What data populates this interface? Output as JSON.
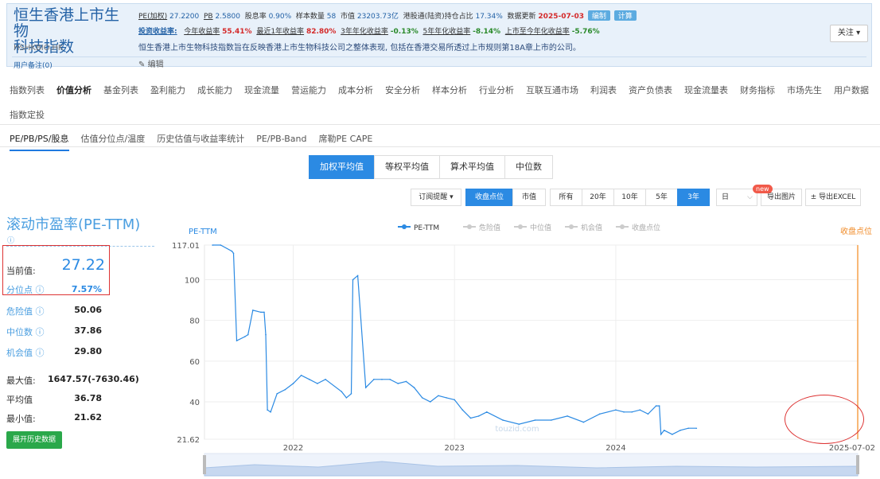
{
  "header": {
    "title_line1": "恒生香港上市生物",
    "title_line2": "科技指数",
    "code": "HSHKBIO.HK",
    "user_note": "用户备注(0)",
    "stats1": [
      {
        "k": "PE(加权)",
        "v": "27.2200"
      },
      {
        "k": "PB",
        "v": "2.5800"
      },
      {
        "k": "股息率",
        "v": "0.90%"
      },
      {
        "k": "样本数量",
        "v": "58"
      },
      {
        "k": "市值",
        "v": "23203.73亿"
      },
      {
        "k": "港股通(陆资)持仓占比",
        "v": "17.34%"
      }
    ],
    "update_label": "数据更新",
    "update_date": "2025-07-03",
    "tag_compile": "编制",
    "tag_calc": "计算",
    "returns_label": "投资收益率:",
    "returns": [
      {
        "k": "今年收益率",
        "v": "55.41%",
        "c": "red"
      },
      {
        "k": "最近1年收益率",
        "v": "82.80%",
        "c": "red"
      },
      {
        "k": "3年年化收益率",
        "v": "-0.13%",
        "c": "green"
      },
      {
        "k": "5年年化收益率",
        "v": "-8.14%",
        "c": "green"
      },
      {
        "k": "上市至今年化收益率",
        "v": "-5.76%",
        "c": "green"
      }
    ],
    "description": "恒生香港上市生物科技指数旨在反映香港上市生物科技公司之整体表现, 包括在香港交易所透过上市规则第18A章上市的公司。",
    "edit_label": "编辑",
    "follow_label": "关注 ▾"
  },
  "nav_main": [
    "指数列表",
    "价值分析",
    "基金列表",
    "盈利能力",
    "成长能力",
    "现金流量",
    "营运能力",
    "成本分析",
    "安全分析",
    "样本分析",
    "行业分析",
    "互联互通市场",
    "利润表",
    "资产负债表",
    "现金流量表",
    "财务指标",
    "市场先生",
    "用户数据"
  ],
  "nav_main_active": "价值分析",
  "nav_main_row2": "指数定投",
  "nav_sub": [
    "PE/PB/PS/股息",
    "估值分位点/温度",
    "历史估值与收益率统计",
    "PE/PB-Band",
    "席勒PE CAPE"
  ],
  "nav_sub_active": "PE/PB/PS/股息",
  "avg_tabs": [
    "加权平均值",
    "等权平均值",
    "算术平均值",
    "中位数"
  ],
  "avg_active": "加权平均值",
  "controls": {
    "subscribe": "订阅提醒 ▾",
    "price_close": "收盘点位",
    "market_cap": "市值",
    "ranges": [
      "所有",
      "20年",
      "10年",
      "5年",
      "3年"
    ],
    "range_active": "3年",
    "period": "日",
    "new_badge": "new",
    "export_img": "导出图片",
    "export_excel": "± 导出EXCEL"
  },
  "left_panel": {
    "title": "滚动市盈率(PE-TTM)",
    "help": "?",
    "current_label": "当前值:",
    "current_value": "27.22",
    "percentile_label": "分位点",
    "percentile_value": "7.57%",
    "danger_label": "危险值",
    "danger_value": "50.06",
    "median_label": "中位数",
    "median_value": "37.86",
    "chance_label": "机会值",
    "chance_value": "29.80",
    "max_label": "最大值:",
    "max_value": "1647.57(-7630.46)",
    "avg_label": "平均值",
    "avg_value": "36.78",
    "min_label": "最小值:",
    "min_value": "21.62",
    "expand_btn": "展开历史数据"
  },
  "chart_data": {
    "type": "line",
    "title": "",
    "ylabel": "PE-TTM",
    "right_axis_label": "收盘点位",
    "legend": [
      "PE-TTM",
      "危险值",
      "中位值",
      "机会值",
      "收盘点位"
    ],
    "ylim": [
      21.62,
      117.01
    ],
    "yticks": [
      "117.01",
      "100",
      "80",
      "60",
      "40",
      "21.62"
    ],
    "xticks": [
      "2022",
      "2023",
      "2024",
      "2025-07-02"
    ],
    "watermark": "touzid.com",
    "series": [
      {
        "name": "PE-TTM",
        "x": [
          2021.5,
          2021.55,
          2021.62,
          2021.63,
          2021.65,
          2021.7,
          2021.72,
          2021.75,
          2021.8,
          2021.82,
          2021.83,
          2021.84,
          2021.86,
          2021.9,
          2021.95,
          2022.0,
          2022.05,
          2022.1,
          2022.15,
          2022.2,
          2022.3,
          2022.33,
          2022.36,
          2022.37,
          2022.4,
          2022.45,
          2022.5,
          2022.55,
          2022.6,
          2022.65,
          2022.7,
          2022.75,
          2022.8,
          2022.85,
          2022.9,
          2022.95,
          2023.0,
          2023.05,
          2023.1,
          2023.15,
          2023.2,
          2023.3,
          2023.4,
          2023.5,
          2023.6,
          2023.7,
          2023.8,
          2023.9,
          2024.0,
          2024.05,
          2024.1,
          2024.15,
          2024.2,
          2024.25,
          2024.27,
          2024.28,
          2024.3,
          2024.35,
          2024.4,
          2024.45,
          2024.5
        ],
        "values": [
          117,
          117,
          114,
          113,
          70,
          72,
          73,
          85,
          84,
          84,
          73,
          36,
          35,
          44,
          46,
          49,
          53,
          51,
          49,
          51,
          45,
          42,
          44,
          100,
          102,
          47,
          51,
          51,
          51,
          49,
          50,
          47,
          42,
          40,
          43,
          42,
          41,
          36,
          32,
          33,
          35,
          31,
          29,
          31,
          31,
          33,
          30,
          34,
          36,
          35,
          35,
          36,
          34,
          38,
          38,
          24,
          26,
          24,
          26,
          27,
          27
        ]
      }
    ]
  }
}
